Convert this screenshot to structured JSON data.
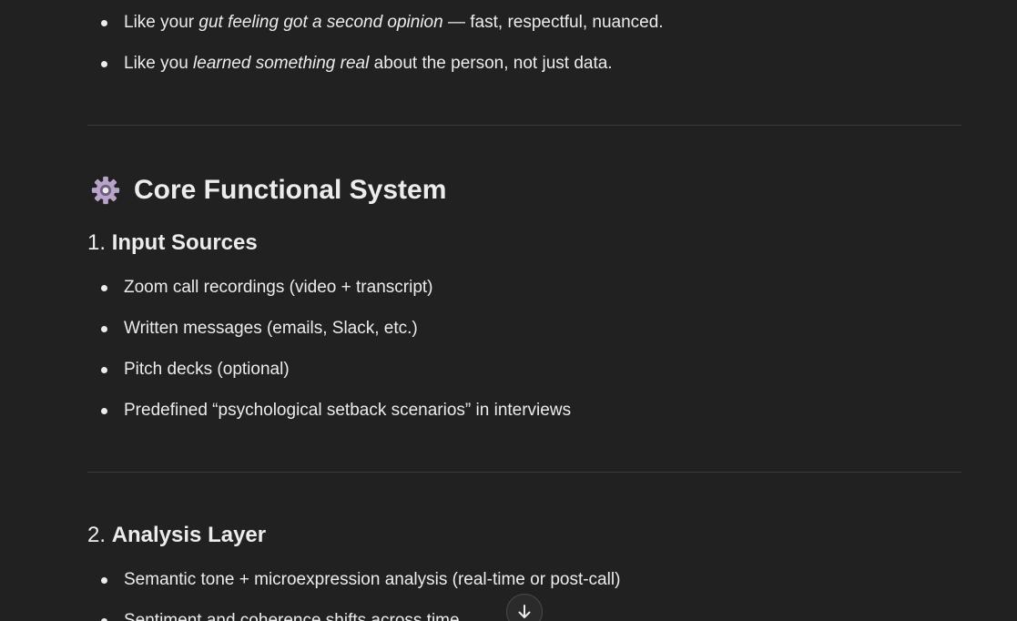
{
  "intro_bullets": [
    {
      "pre": "Like your ",
      "em": "gut feeling got a second opinion",
      "post": " — fast, respectful, nuanced."
    },
    {
      "pre": "Like you ",
      "em": "learned something real",
      "post": " about the person, not just data."
    }
  ],
  "section": {
    "heading": "Core Functional System",
    "icon": "gear-emoji"
  },
  "input_sources": {
    "number": "1.",
    "title": "Input Sources",
    "items": [
      "Zoom call recordings (video + transcript)",
      "Written messages (emails, Slack, etc.)",
      "Pitch decks (optional)",
      "Predefined “psychological setback scenarios” in interviews"
    ]
  },
  "analysis_layer": {
    "number": "2.",
    "title": "Analysis Layer",
    "items": [
      "Semantic tone + microexpression analysis (real-time or post-call)",
      "Sentiment and coherence shifts across time"
    ]
  },
  "scroll_button": {
    "icon": "arrow-down-icon"
  }
}
